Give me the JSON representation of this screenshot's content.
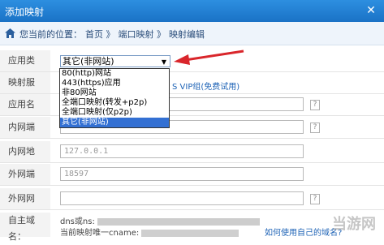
{
  "window": {
    "title": "添加映射"
  },
  "breadcrumb": {
    "prefix": "您当前的位置：",
    "home": "首页",
    "sep1": "》",
    "port_mapping": "端口映射",
    "sep2": "》",
    "mapping_edit": "映射编辑"
  },
  "form": {
    "app_type_label": "应用类型：",
    "app_type_value": "其它(非网站)",
    "app_type_options": [
      "80(http)网站",
      "443(https)应用",
      "非80网站",
      "全端口映射(转发+p2p)",
      "全端口映射(仅p2p)",
      "其它(非网站)"
    ],
    "mapping_service_label": "映射服务：",
    "vip_text": "S VIP组(免费试用)",
    "app_name_label": "应用名称：",
    "internal_port_label": "内网端口：",
    "internal_addr_label": "内网地址：",
    "internal_addr_placeholder": "127.0.0.1",
    "external_port_label": "外网端口：",
    "external_port_placeholder": "18597",
    "external_addr_label": "外网网址：",
    "help": "?",
    "domain_label": "自主域名：",
    "domain_line1_prefix": "dns或ns:",
    "domain_line2_prefix": "当前映射唯一cname:",
    "domain_link": "如何使用自己的域名?"
  },
  "watermark": "当游网",
  "colors": {
    "titlebar": "#1a72c6",
    "selected": "#3370d3",
    "arrow": "#d9262b",
    "link": "#1e63b6"
  }
}
